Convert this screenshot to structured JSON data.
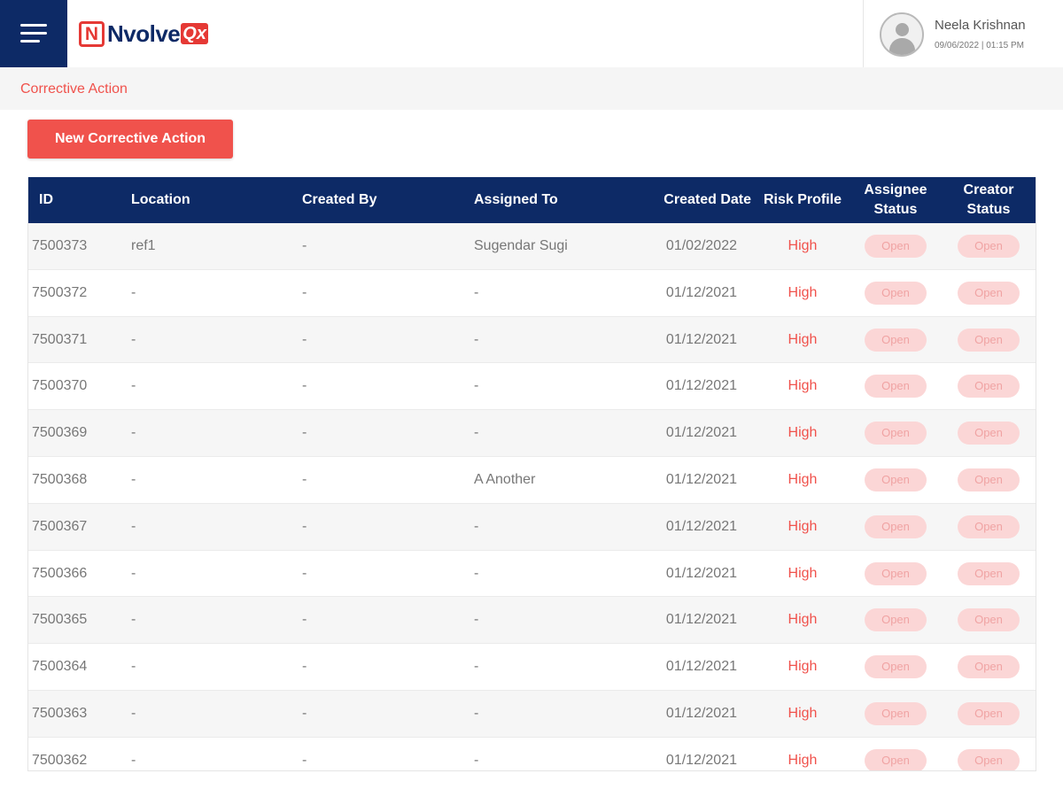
{
  "header": {
    "menu_icon": "hamburger-menu-icon",
    "logo": {
      "letter": "N",
      "brand": "Nvolve",
      "accent": "Qx"
    },
    "user": {
      "name": "Neela Krishnan",
      "datetime": "09/06/2022 | 01:15 PM",
      "avatar_icon": "user-avatar-icon"
    }
  },
  "breadcrumb": {
    "label": "Corrective Action"
  },
  "actions": {
    "new_label": "New Corrective Action"
  },
  "colors": {
    "navy": "#0d2a66",
    "accent": "#f0524c",
    "badge_bg": "#fbd6d6"
  },
  "table": {
    "headers": {
      "id": "ID",
      "location": "Location",
      "created_by": "Created By",
      "assigned_to": "Assigned To",
      "created_date": "Created Date",
      "risk_profile": "Risk Profile",
      "assignee_status": "Assignee Status",
      "creator_status": "Creator Status"
    },
    "rows": [
      {
        "id": "7500373",
        "location": "ref1",
        "created_by": "-",
        "assigned_to": "Sugendar Sugi",
        "created_date": "01/02/2022",
        "risk": "High",
        "assignee_status": "Open",
        "creator_status": "Open"
      },
      {
        "id": "7500372",
        "location": "-",
        "created_by": "-",
        "assigned_to": "-",
        "created_date": "01/12/2021",
        "risk": "High",
        "assignee_status": "Open",
        "creator_status": "Open"
      },
      {
        "id": "7500371",
        "location": "-",
        "created_by": "-",
        "assigned_to": "-",
        "created_date": "01/12/2021",
        "risk": "High",
        "assignee_status": "Open",
        "creator_status": "Open"
      },
      {
        "id": "7500370",
        "location": "-",
        "created_by": "-",
        "assigned_to": "-",
        "created_date": "01/12/2021",
        "risk": "High",
        "assignee_status": "Open",
        "creator_status": "Open"
      },
      {
        "id": "7500369",
        "location": "-",
        "created_by": "-",
        "assigned_to": "-",
        "created_date": "01/12/2021",
        "risk": "High",
        "assignee_status": "Open",
        "creator_status": "Open"
      },
      {
        "id": "7500368",
        "location": "-",
        "created_by": "-",
        "assigned_to": "A Another",
        "created_date": "01/12/2021",
        "risk": "High",
        "assignee_status": "Open",
        "creator_status": "Open"
      },
      {
        "id": "7500367",
        "location": "-",
        "created_by": "-",
        "assigned_to": "-",
        "created_date": "01/12/2021",
        "risk": "High",
        "assignee_status": "Open",
        "creator_status": "Open"
      },
      {
        "id": "7500366",
        "location": "-",
        "created_by": "-",
        "assigned_to": "-",
        "created_date": "01/12/2021",
        "risk": "High",
        "assignee_status": "Open",
        "creator_status": "Open"
      },
      {
        "id": "7500365",
        "location": "-",
        "created_by": "-",
        "assigned_to": "-",
        "created_date": "01/12/2021",
        "risk": "High",
        "assignee_status": "Open",
        "creator_status": "Open"
      },
      {
        "id": "7500364",
        "location": "-",
        "created_by": "-",
        "assigned_to": "-",
        "created_date": "01/12/2021",
        "risk": "High",
        "assignee_status": "Open",
        "creator_status": "Open"
      },
      {
        "id": "7500363",
        "location": "-",
        "created_by": "-",
        "assigned_to": "-",
        "created_date": "01/12/2021",
        "risk": "High",
        "assignee_status": "Open",
        "creator_status": "Open"
      },
      {
        "id": "7500362",
        "location": "-",
        "created_by": "-",
        "assigned_to": "-",
        "created_date": "01/12/2021",
        "risk": "High",
        "assignee_status": "Open",
        "creator_status": "Open"
      }
    ]
  }
}
